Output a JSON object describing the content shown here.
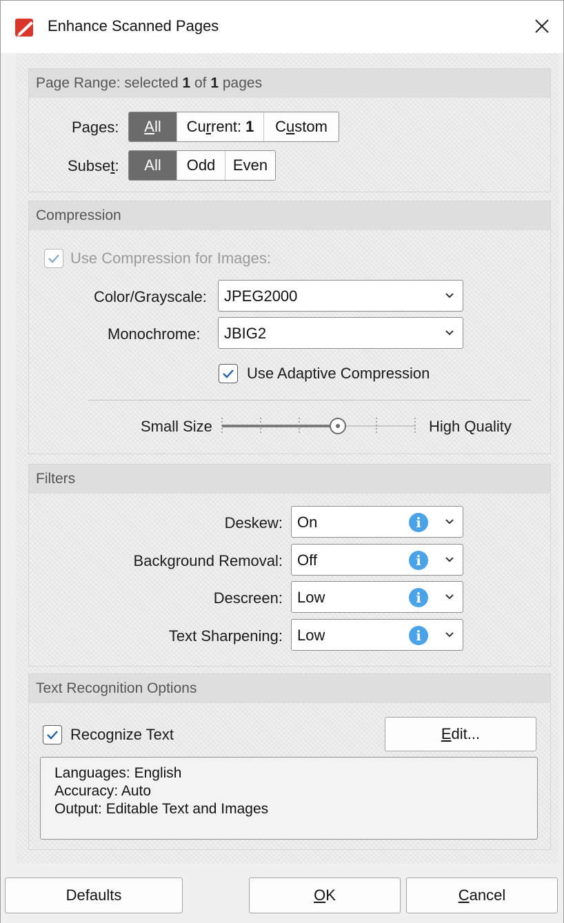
{
  "window": {
    "title": "Enhance Scanned Pages"
  },
  "page_range": {
    "header_prefix": "Page Range: selected ",
    "selected": "1",
    "header_mid": " of ",
    "total": "1",
    "header_suffix": " pages",
    "pages_label_pre": "Pages",
    "pages_label_post": ":",
    "pages_options": {
      "all": {
        "pre": "",
        "u": "A",
        "post": "ll"
      },
      "current": {
        "pre": "Cu",
        "u": "r",
        "post": "rent: ",
        "num": "1"
      },
      "custom": {
        "pre": "C",
        "u": "u",
        "post": "stom"
      }
    },
    "subset_label_pre": "Subse",
    "subset_label_u": "t",
    "subset_label_post": ":",
    "subset_options": [
      "All",
      "Odd",
      "Even"
    ]
  },
  "compression": {
    "header": "Compression",
    "use_compression_label": "Use Compression for Images:",
    "color_label": "Color/Grayscale:",
    "color_value": "JPEG2000",
    "mono_label": "Monochrome:",
    "mono_value": "JBIG2",
    "adaptive_label": "Use Adaptive Compression",
    "slider_min_label": "Small Size",
    "slider_max_label": "High Quality",
    "slider_level": 0.6
  },
  "filters": {
    "header": "Filters",
    "rows": [
      {
        "label": "Deskew:",
        "value": "On"
      },
      {
        "label": "Background Removal:",
        "value": "Off"
      },
      {
        "label": "Descreen:",
        "value": "Low"
      },
      {
        "label": "Text Sharpening:",
        "value": "Low"
      }
    ]
  },
  "ocr": {
    "header": "Text Recognition Options",
    "recognize_label": "Recognize Text",
    "edit_u": "E",
    "edit_rest": "dit...",
    "details": [
      "Languages: English",
      "Accuracy: Auto",
      "Output: Editable Text and Images"
    ]
  },
  "footer": {
    "defaults_label": "Defaults",
    "ok_u": "O",
    "ok_rest": "K",
    "cancel_u": "C",
    "cancel_rest": "ancel"
  },
  "colors": {
    "segment_active": "#6b6b6b",
    "info_icon": "#4aa3e8",
    "app_icon": "#d9362b"
  }
}
